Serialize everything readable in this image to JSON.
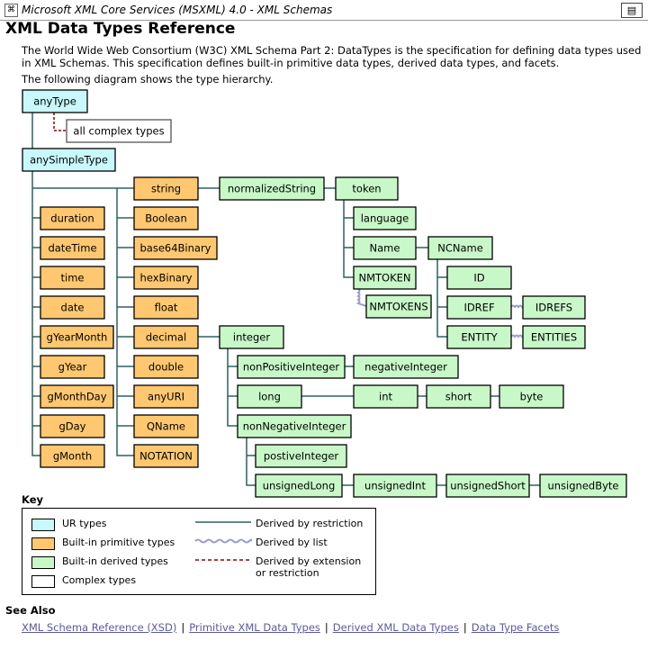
{
  "window": {
    "title": "Microsoft XML Core Services (MSXML) 4.0 - XML Schemas"
  },
  "page": {
    "heading": "XML Data Types Reference",
    "intro_line1": "The World Wide Web Consortium (W3C) XML Schema Part 2: DataTypes is the specification for defining data types used",
    "intro_line2": "in XML Schemas. This specification defines built-in primitive data types, derived data types, and facets.",
    "diagram_intro": "The following diagram shows the type hierarchy."
  },
  "colors": {
    "ur": "#c8f8fc",
    "primitive": "#ffc870",
    "derived": "#c8f8c8",
    "complex": "#ffffff",
    "restriction": "#2e6060",
    "list": "#9a9ad0",
    "extension": "#990000"
  },
  "diagram": {
    "nodes": {
      "anyType": "anyType",
      "complex": "all complex types",
      "anySimpleType": "anySimpleType",
      "duration": "duration",
      "dateTime": "dateTime",
      "time": "time",
      "date": "date",
      "gYearMonth": "gYearMonth",
      "gYear": "gYear",
      "gMonthDay": "gMonthDay",
      "gDay": "gDay",
      "gMonth": "gMonth",
      "string": "string",
      "Boolean": "Boolean",
      "base64Binary": "base64Binary",
      "hexBinary": "hexBinary",
      "float": "float",
      "decimal": "decimal",
      "double": "double",
      "anyURI": "anyURI",
      "QName": "QName",
      "NOTATION": "NOTATION",
      "normalizedString": "normalizedString",
      "token": "token",
      "language": "language",
      "Name": "Name",
      "NCName": "NCName",
      "NMTOKEN": "NMTOKEN",
      "NMTOKENS": "NMTOKENS",
      "ID": "ID",
      "IDREF": "IDREF",
      "IDREFS": "IDREFS",
      "ENTITY": "ENTITY",
      "ENTITIES": "ENTITIES",
      "integer": "integer",
      "nonPositiveInteger": "nonPositiveInteger",
      "negativeInteger": "negativeInteger",
      "long": "long",
      "int": "int",
      "short": "short",
      "byte": "byte",
      "nonNegativeInteger": "nonNegativeInteger",
      "postiveInteger": "postiveInteger",
      "unsignedLong": "unsignedLong",
      "unsignedInt": "unsignedInt",
      "unsignedShort": "unsignedShort",
      "unsignedByte": "unsignedByte"
    }
  },
  "key": {
    "heading": "Key",
    "ur": "UR types",
    "primitive": "Built-in primitive types",
    "derived": "Built-in derived types",
    "complex": "Complex types",
    "restriction": "Derived by restriction",
    "list": "Derived by list",
    "extension_line1": "Derived by extension",
    "extension_line2": "or restriction"
  },
  "see_also": {
    "heading": "See Also",
    "links": [
      "XML Schema Reference (XSD)",
      "Primitive XML Data Types",
      "Derived XML Data Types",
      "Data Type Facets"
    ]
  }
}
